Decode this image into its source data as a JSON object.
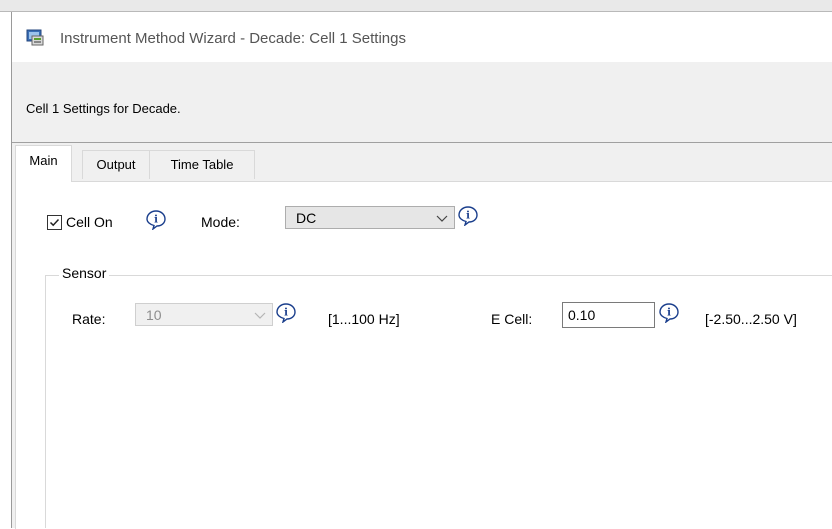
{
  "window": {
    "title": "Instrument Method Wizard - Decade: Cell 1 Settings",
    "icon": "wizard-app-icon"
  },
  "header": {
    "description": "Cell 1 Settings for Decade."
  },
  "tabs": [
    {
      "label": "Main",
      "active": true
    },
    {
      "label": "Output",
      "active": false
    },
    {
      "label": "Time Table",
      "active": false
    }
  ],
  "main": {
    "cell_on": {
      "label": "Cell On",
      "checked": true
    },
    "mode": {
      "label": "Mode:",
      "value": "DC"
    },
    "sensor": {
      "title": "Sensor",
      "rate": {
        "label": "Rate:",
        "value": "10",
        "range": "[1...100 Hz]",
        "enabled": false
      },
      "e_cell": {
        "label": "E Cell:",
        "value": "0.10",
        "range": "[-2.50...2.50 V]"
      }
    }
  },
  "colors": {
    "accent_info": "#1a3e8c",
    "info_bg": "#ffffff",
    "header_bg": "#f0f0f0"
  }
}
